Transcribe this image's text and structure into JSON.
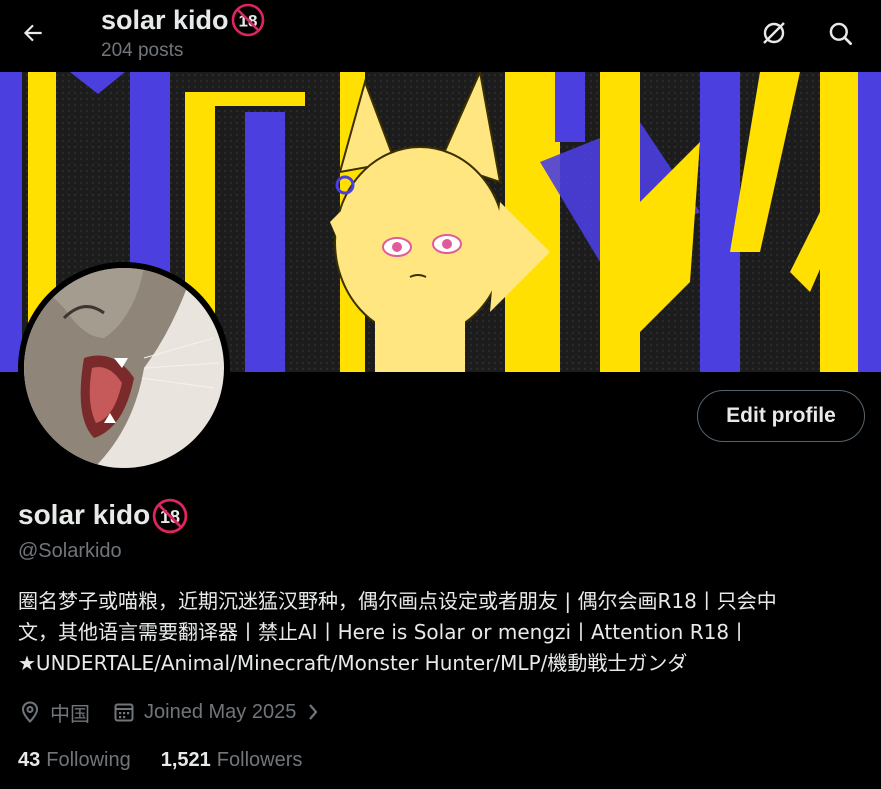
{
  "header": {
    "display_name": "solar kido",
    "badge_text": "18",
    "post_count": "204 posts"
  },
  "profile": {
    "display_name": "solar kido",
    "badge_text": "18",
    "handle": "@Solarkido",
    "edit_button": "Edit profile",
    "bio_lines": [
      "圈名梦子或喵粮，近期沉迷猛汉野种，偶尔画点设定或者朋友 | 偶尔会画R18丨只会中",
      "文，其他语言需要翻译器丨禁止AI丨Here is Solar or mengzi丨Attention R18丨",
      "★UNDERTALE/Animal/Minecraft/Monster Hunter/MLP/機動戦士ガンダ"
    ],
    "location": "中国",
    "joined": "Joined May 2025",
    "following_count": "43",
    "following_label": "Following",
    "followers_count": "1,521",
    "followers_label": "Followers"
  },
  "icons": {
    "back": "arrow-left-icon",
    "grok": "slash-circle-icon",
    "search": "search-icon",
    "location": "location-pin-icon",
    "calendar": "calendar-icon",
    "chevron": "chevron-right-icon"
  },
  "colors": {
    "background": "#000000",
    "text": "#e7e9ea",
    "secondary_text": "#71767b",
    "banner_yellow": "#ffe000",
    "banner_blue": "#4b3fe0",
    "badge_red": "#e0245e"
  }
}
